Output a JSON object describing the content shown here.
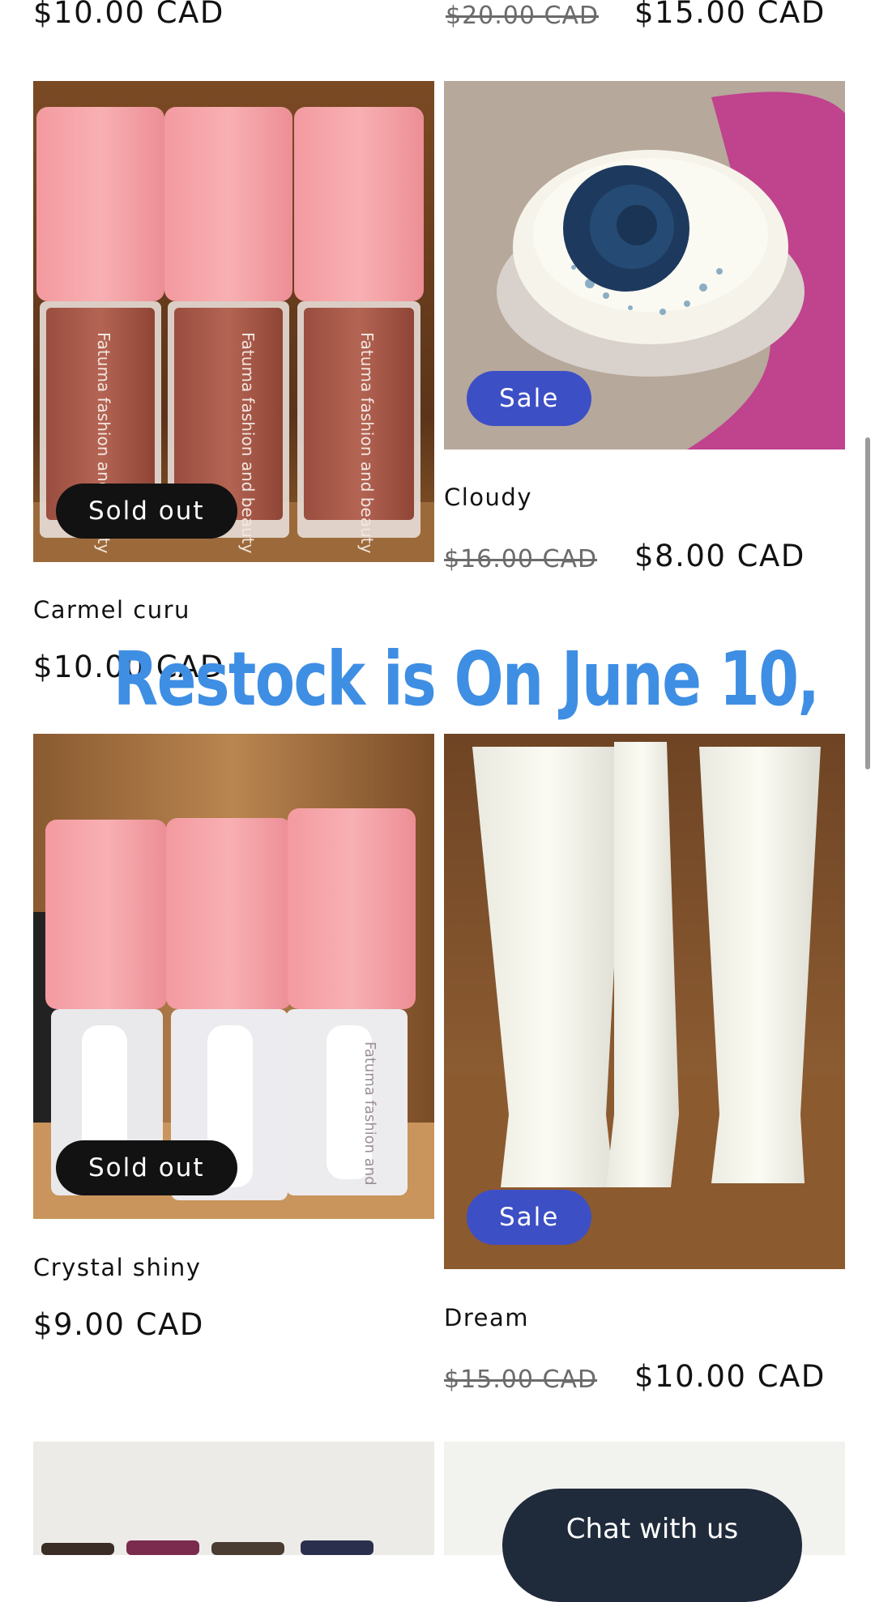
{
  "top_row": {
    "left_price": "$10.00 CAD",
    "right_compare_price": "$20.00 CAD",
    "right_price": "$15.00 CAD"
  },
  "products": [
    {
      "name": "Carmel curu",
      "price": "$10.00 CAD",
      "badge": "Sold out",
      "image_label": "Fatuma fashion and beauty"
    },
    {
      "name": "Cloudy",
      "compare_price": "$16.00 CAD",
      "price": "$8.00 CAD",
      "badge": "Sale"
    },
    {
      "name": "Crystal shiny",
      "price": "$9.00 CAD",
      "badge": "Sold out",
      "image_label": "Fatuma fashion and"
    },
    {
      "name": "Dream",
      "compare_price": "$15.00 CAD",
      "price": "$10.00 CAD",
      "badge": "Sale"
    }
  ],
  "overlay": {
    "text": "Restock is On June 10,"
  },
  "chat": {
    "label": "Chat with us"
  },
  "colors": {
    "sale_badge": "#3d4fc5",
    "soldout_badge": "#121212",
    "overlay_text": "#3e8ee4",
    "chat_button": "#1f2a3a"
  }
}
